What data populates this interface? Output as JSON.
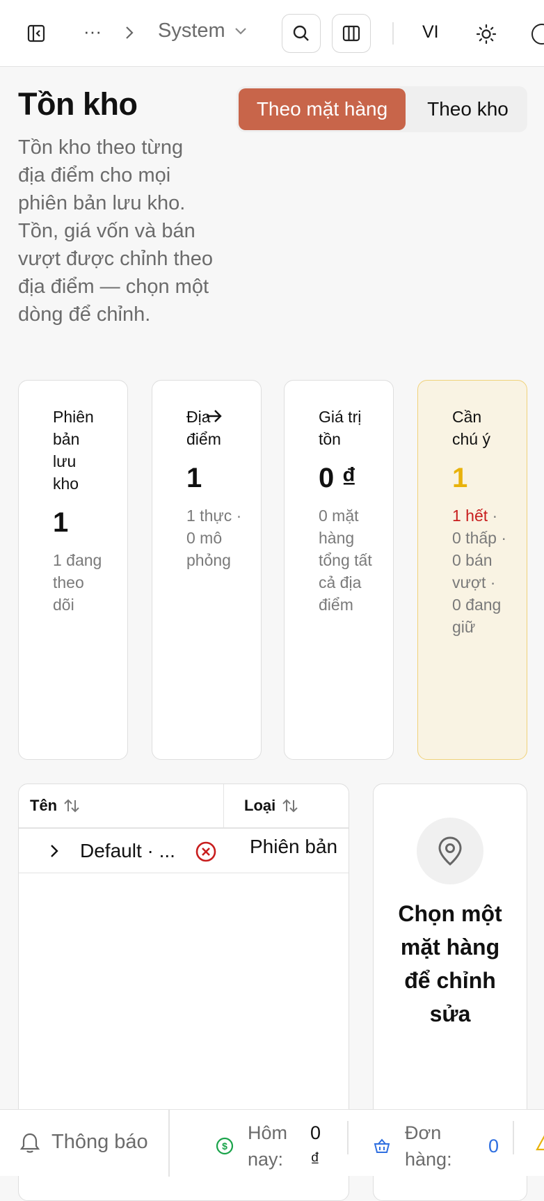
{
  "topbar": {
    "breadcrumb_more": "···",
    "breadcrumb_current": "System",
    "language": "VI"
  },
  "header": {
    "title": "Tồn kho",
    "description": "Tồn kho theo từng địa điểm cho mọi phiên bản lưu kho. Tồn, giá vốn và bán vượt được chỉnh theo địa điểm — chọn một dòng để chỉnh.",
    "view_toggle": {
      "active": "Theo mặt hàng",
      "inactive": "Theo kho"
    }
  },
  "stats": [
    {
      "label": "Phiên bản lưu kho",
      "value": "1",
      "sub": "1 đang theo dõi"
    },
    {
      "label": "Địa điểm",
      "value": "1",
      "sub": "1 thực · 0 mô phỏng"
    },
    {
      "label": "Giá trị tồn",
      "value": "0 ₫",
      "sub": "0 mặt hàng tổng tất cả địa điểm"
    },
    {
      "label": "Cần chú ý",
      "value": "1",
      "sub_alert": "1 hết",
      "sub": "· 0 thấp · 0 bán vượt · 0 đang giữ"
    }
  ],
  "table": {
    "columns": [
      "Tên",
      "Loại"
    ],
    "rows": [
      {
        "name": "Default · ...",
        "type": "Phiên bản"
      }
    ]
  },
  "detail_panel": {
    "empty_text": "Chọn một mặt hàng để chỉnh sửa"
  },
  "bottombar": {
    "notifications": "Thông báo",
    "today_label": "Hôm nay:",
    "today_value": "0 ₫",
    "orders_label": "Đơn hàng:",
    "orders_value": "0"
  },
  "colors": {
    "accent": "#c8654a",
    "warning_bg": "#f9f3e3",
    "warning_value": "#e8b20c",
    "alert_red": "#c81e1e",
    "money_green": "#1aa34a",
    "order_blue": "#2f6fe0"
  }
}
